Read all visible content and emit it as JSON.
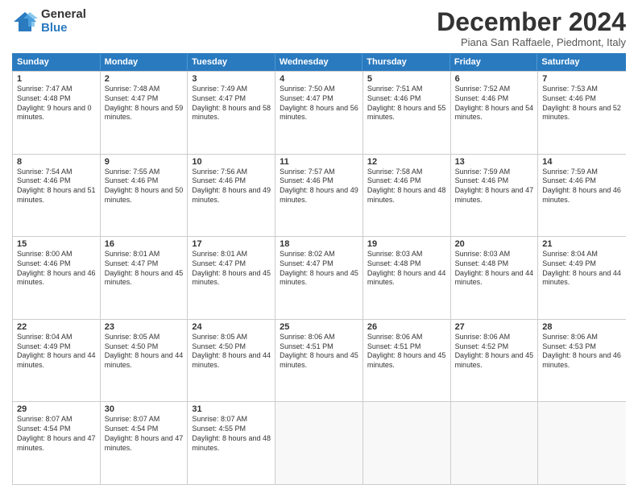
{
  "logo": {
    "line1": "General",
    "line2": "Blue"
  },
  "title": "December 2024",
  "subtitle": "Piana San Raffaele, Piedmont, Italy",
  "header_days": [
    "Sunday",
    "Monday",
    "Tuesday",
    "Wednesday",
    "Thursday",
    "Friday",
    "Saturday"
  ],
  "weeks": [
    [
      {
        "day": "1",
        "sunrise": "Sunrise: 7:47 AM",
        "sunset": "Sunset: 4:48 PM",
        "daylight": "Daylight: 9 hours and 0 minutes."
      },
      {
        "day": "2",
        "sunrise": "Sunrise: 7:48 AM",
        "sunset": "Sunset: 4:47 PM",
        "daylight": "Daylight: 8 hours and 59 minutes."
      },
      {
        "day": "3",
        "sunrise": "Sunrise: 7:49 AM",
        "sunset": "Sunset: 4:47 PM",
        "daylight": "Daylight: 8 hours and 58 minutes."
      },
      {
        "day": "4",
        "sunrise": "Sunrise: 7:50 AM",
        "sunset": "Sunset: 4:47 PM",
        "daylight": "Daylight: 8 hours and 56 minutes."
      },
      {
        "day": "5",
        "sunrise": "Sunrise: 7:51 AM",
        "sunset": "Sunset: 4:46 PM",
        "daylight": "Daylight: 8 hours and 55 minutes."
      },
      {
        "day": "6",
        "sunrise": "Sunrise: 7:52 AM",
        "sunset": "Sunset: 4:46 PM",
        "daylight": "Daylight: 8 hours and 54 minutes."
      },
      {
        "day": "7",
        "sunrise": "Sunrise: 7:53 AM",
        "sunset": "Sunset: 4:46 PM",
        "daylight": "Daylight: 8 hours and 52 minutes."
      }
    ],
    [
      {
        "day": "8",
        "sunrise": "Sunrise: 7:54 AM",
        "sunset": "Sunset: 4:46 PM",
        "daylight": "Daylight: 8 hours and 51 minutes."
      },
      {
        "day": "9",
        "sunrise": "Sunrise: 7:55 AM",
        "sunset": "Sunset: 4:46 PM",
        "daylight": "Daylight: 8 hours and 50 minutes."
      },
      {
        "day": "10",
        "sunrise": "Sunrise: 7:56 AM",
        "sunset": "Sunset: 4:46 PM",
        "daylight": "Daylight: 8 hours and 49 minutes."
      },
      {
        "day": "11",
        "sunrise": "Sunrise: 7:57 AM",
        "sunset": "Sunset: 4:46 PM",
        "daylight": "Daylight: 8 hours and 49 minutes."
      },
      {
        "day": "12",
        "sunrise": "Sunrise: 7:58 AM",
        "sunset": "Sunset: 4:46 PM",
        "daylight": "Daylight: 8 hours and 48 minutes."
      },
      {
        "day": "13",
        "sunrise": "Sunrise: 7:59 AM",
        "sunset": "Sunset: 4:46 PM",
        "daylight": "Daylight: 8 hours and 47 minutes."
      },
      {
        "day": "14",
        "sunrise": "Sunrise: 7:59 AM",
        "sunset": "Sunset: 4:46 PM",
        "daylight": "Daylight: 8 hours and 46 minutes."
      }
    ],
    [
      {
        "day": "15",
        "sunrise": "Sunrise: 8:00 AM",
        "sunset": "Sunset: 4:46 PM",
        "daylight": "Daylight: 8 hours and 46 minutes."
      },
      {
        "day": "16",
        "sunrise": "Sunrise: 8:01 AM",
        "sunset": "Sunset: 4:47 PM",
        "daylight": "Daylight: 8 hours and 45 minutes."
      },
      {
        "day": "17",
        "sunrise": "Sunrise: 8:01 AM",
        "sunset": "Sunset: 4:47 PM",
        "daylight": "Daylight: 8 hours and 45 minutes."
      },
      {
        "day": "18",
        "sunrise": "Sunrise: 8:02 AM",
        "sunset": "Sunset: 4:47 PM",
        "daylight": "Daylight: 8 hours and 45 minutes."
      },
      {
        "day": "19",
        "sunrise": "Sunrise: 8:03 AM",
        "sunset": "Sunset: 4:48 PM",
        "daylight": "Daylight: 8 hours and 44 minutes."
      },
      {
        "day": "20",
        "sunrise": "Sunrise: 8:03 AM",
        "sunset": "Sunset: 4:48 PM",
        "daylight": "Daylight: 8 hours and 44 minutes."
      },
      {
        "day": "21",
        "sunrise": "Sunrise: 8:04 AM",
        "sunset": "Sunset: 4:49 PM",
        "daylight": "Daylight: 8 hours and 44 minutes."
      }
    ],
    [
      {
        "day": "22",
        "sunrise": "Sunrise: 8:04 AM",
        "sunset": "Sunset: 4:49 PM",
        "daylight": "Daylight: 8 hours and 44 minutes."
      },
      {
        "day": "23",
        "sunrise": "Sunrise: 8:05 AM",
        "sunset": "Sunset: 4:50 PM",
        "daylight": "Daylight: 8 hours and 44 minutes."
      },
      {
        "day": "24",
        "sunrise": "Sunrise: 8:05 AM",
        "sunset": "Sunset: 4:50 PM",
        "daylight": "Daylight: 8 hours and 44 minutes."
      },
      {
        "day": "25",
        "sunrise": "Sunrise: 8:06 AM",
        "sunset": "Sunset: 4:51 PM",
        "daylight": "Daylight: 8 hours and 45 minutes."
      },
      {
        "day": "26",
        "sunrise": "Sunrise: 8:06 AM",
        "sunset": "Sunset: 4:51 PM",
        "daylight": "Daylight: 8 hours and 45 minutes."
      },
      {
        "day": "27",
        "sunrise": "Sunrise: 8:06 AM",
        "sunset": "Sunset: 4:52 PM",
        "daylight": "Daylight: 8 hours and 45 minutes."
      },
      {
        "day": "28",
        "sunrise": "Sunrise: 8:06 AM",
        "sunset": "Sunset: 4:53 PM",
        "daylight": "Daylight: 8 hours and 46 minutes."
      }
    ],
    [
      {
        "day": "29",
        "sunrise": "Sunrise: 8:07 AM",
        "sunset": "Sunset: 4:54 PM",
        "daylight": "Daylight: 8 hours and 47 minutes."
      },
      {
        "day": "30",
        "sunrise": "Sunrise: 8:07 AM",
        "sunset": "Sunset: 4:54 PM",
        "daylight": "Daylight: 8 hours and 47 minutes."
      },
      {
        "day": "31",
        "sunrise": "Sunrise: 8:07 AM",
        "sunset": "Sunset: 4:55 PM",
        "daylight": "Daylight: 8 hours and 48 minutes."
      },
      null,
      null,
      null,
      null
    ]
  ]
}
